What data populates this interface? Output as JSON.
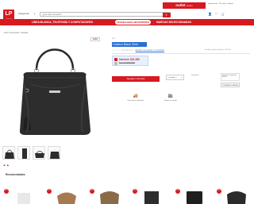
{
  "header": {
    "logo_text": "LP",
    "logo_sub": "OUTLET",
    "category_select": "Categorías",
    "search_placeholder": "¿Qué estás buscando?",
    "outlet_label": "outlet",
    "outlet_suffix": "online",
    "top_links": "Seguimiento · Mi cuenta · Ayuda"
  },
  "nav": {
    "items": [
      "LÍNEA BLANCA, TELEFONÍA Y COMPUTADORES",
      "TECNOLOGÍA SIN INTERÉS",
      "MARCAS SELECCIONADAS"
    ]
  },
  "breadcrumb": "Inicio  /  Accesorios  /  Carteras",
  "product": {
    "brand_badge": "outlet",
    "sku": "SKU",
    "title": "Cartera Black Zibel",
    "reviews_count": "(0) Opiniones",
    "reviews_link": "Escribe una opinión / comentario",
    "seller": "Vendido y despachado por: LPOutlet",
    "price_internet": "Internet: $21.950",
    "price_normal": "Normal: $39.900",
    "add_to_cart": "Agregar a la bolsa",
    "quantity_label": "Cantidad: 1",
    "availability": "Disponible",
    "shipping_info": "Despacho a domicilio: $3.990",
    "cuotas": "3 cuotas sin interés",
    "services": [
      {
        "icon": "truck-icon",
        "label": "Despacho a domicilio"
      },
      {
        "icon": "store-icon",
        "label": "Retiro en tienda"
      }
    ]
  },
  "gallery": {
    "thumb_nav": "◀ ▶"
  },
  "recommendations": {
    "title": "Recomendados",
    "badge": "OFF",
    "items": [
      {
        "badge": "OFF"
      },
      {
        "badge": "OFF"
      },
      {
        "badge": "OFF"
      },
      {
        "badge": "OFF"
      },
      {
        "badge": "OFF"
      },
      {
        "badge": "OFF"
      }
    ]
  },
  "colors": {
    "brand": "#d71920",
    "title_highlight": "#2a6fd6",
    "price_box": "#e8f0fd"
  }
}
